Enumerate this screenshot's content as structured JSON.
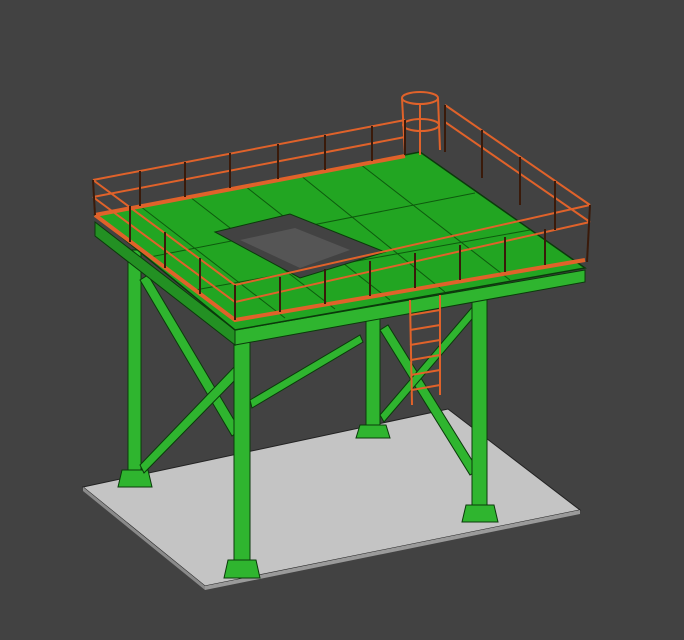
{
  "viewport": {
    "background_color": "#424242",
    "model": "steel-platform",
    "colors": {
      "structure": "#2fb52f",
      "structure_dark": "#0b3a0b",
      "railing": "#e0622a",
      "railing_dark": "#3a1a0a",
      "base_plate": "#c4c4c4"
    }
  }
}
